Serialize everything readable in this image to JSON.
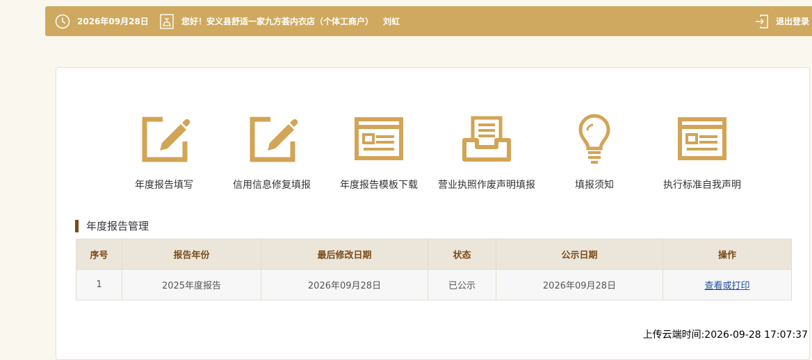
{
  "header": {
    "date": "2026年09月28日",
    "greeting": "您好！安义县舒适一家九方荟内衣店（个体工商户）",
    "user_name": "刘虹",
    "logout_label": "退出登录",
    "icons": {
      "clock": "clock-icon",
      "seal": "seal-icon",
      "logout": "logout-icon"
    }
  },
  "menu": [
    {
      "label": "年度报告填写",
      "icon": "edit-icon"
    },
    {
      "label": "信用信息修复填报",
      "icon": "edit-icon"
    },
    {
      "label": "年度报告模板下载",
      "icon": "document-icon"
    },
    {
      "label": "营业执照作废声明填报",
      "icon": "inbox-tray-icon"
    },
    {
      "label": "填报须知",
      "icon": "lightbulb-icon"
    },
    {
      "label": "执行标准自我声明",
      "icon": "document-icon"
    }
  ],
  "section": {
    "title": "年度报告管理"
  },
  "table": {
    "headers": [
      "序号",
      "报告年份",
      "最后修改日期",
      "状态",
      "公示日期",
      "操作"
    ],
    "rows": [
      [
        "1",
        "2025年度报告",
        "2026年09月28日",
        "已公示",
        "2026年09月28日",
        "查看或打印"
      ]
    ]
  },
  "footer": {
    "upload_time": "上传云端时间:2026-09-28 17:07:37"
  },
  "colors": {
    "accent": "#cfa95f",
    "icon": "#d2a456",
    "section_bar": "#7a4a1a",
    "table_header_bg": "#ece6da",
    "link": "#1f4ea0"
  }
}
